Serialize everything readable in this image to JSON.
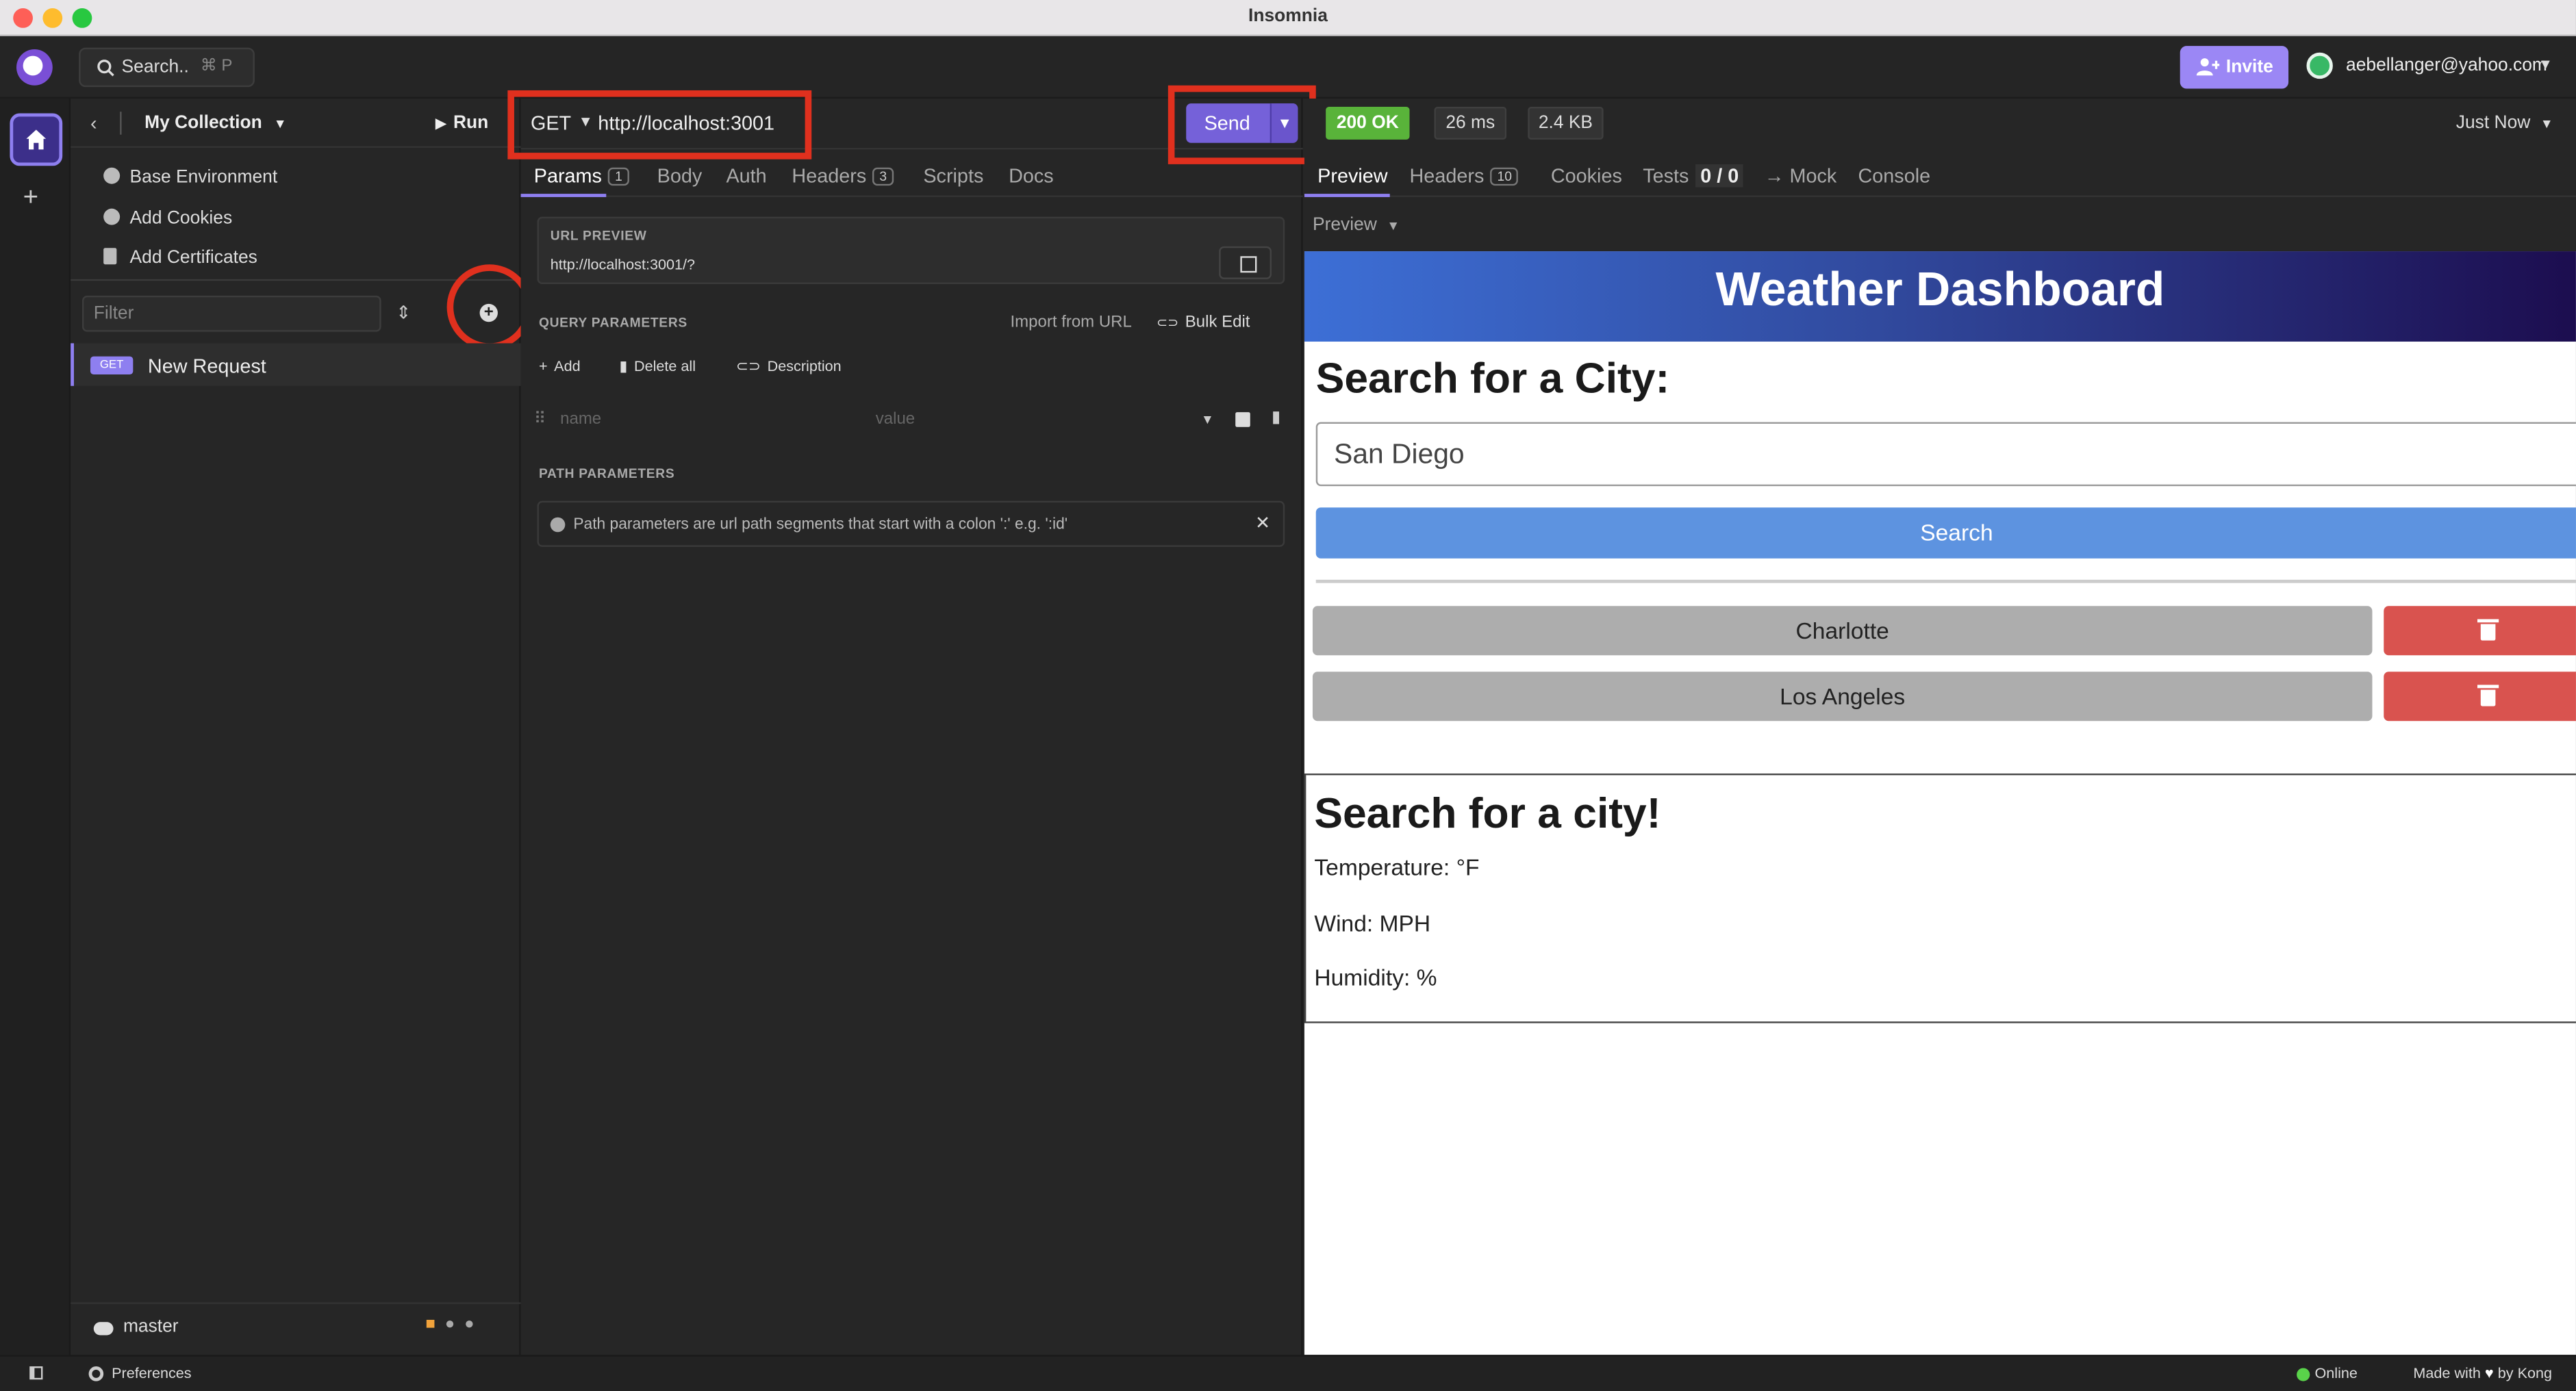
{
  "window": {
    "title": "Insomnia"
  },
  "topbar": {
    "search_label": "Search..",
    "search_shortcut": "⌘ P",
    "invite_label": "Invite",
    "user_email": "aebellanger@yahoo.com"
  },
  "sidebar": {
    "collection_name": "My Collection",
    "run_label": "Run",
    "items": [
      {
        "label": "Base Environment",
        "icon": "globe-icon"
      },
      {
        "label": "Add Cookies",
        "icon": "cookie-icon"
      },
      {
        "label": "Add Certificates",
        "icon": "certificate-icon"
      }
    ],
    "filter_placeholder": "Filter",
    "requests": [
      {
        "method": "GET",
        "name": "New Request"
      }
    ],
    "branch": "master"
  },
  "request": {
    "method": "GET",
    "url": "http://localhost:3001",
    "send_label": "Send",
    "tabs": [
      {
        "label": "Params",
        "count": "1"
      },
      {
        "label": "Body"
      },
      {
        "label": "Auth"
      },
      {
        "label": "Headers",
        "count": "3"
      },
      {
        "label": "Scripts"
      },
      {
        "label": "Docs"
      }
    ],
    "url_preview_label": "URL PREVIEW",
    "url_preview_value": "http://localhost:3001/?",
    "query_params_label": "QUERY PARAMETERS",
    "import_from_url": "Import from URL",
    "bulk_edit": "Bulk Edit",
    "add_label": "Add",
    "delete_all_label": "Delete all",
    "description_label": "Description",
    "name_placeholder": "name",
    "value_placeholder": "value",
    "path_params_label": "PATH PARAMETERS",
    "path_params_info": "Path parameters are url path segments that start with a colon ':' e.g. ':id'"
  },
  "response": {
    "status": "200 OK",
    "time": "26 ms",
    "size": "2.4 KB",
    "timestamp": "Just Now",
    "tabs": [
      {
        "label": "Preview"
      },
      {
        "label": "Headers",
        "count": "10"
      },
      {
        "label": "Cookies"
      },
      {
        "label": "Tests",
        "count": "0 / 0"
      },
      {
        "label": "→ Mock"
      },
      {
        "label": "Console"
      }
    ],
    "preview_mode": "Preview"
  },
  "webpage": {
    "title": "Weather Dashboard",
    "search_heading": "Search for a City:",
    "search_value": "San Diego",
    "search_button": "Search",
    "history": [
      "Charlotte",
      "Los Angeles"
    ],
    "weather_heading": "Search for a city!",
    "temperature": "Temperature: °F",
    "wind": "Wind: MPH",
    "humidity": "Humidity: %"
  },
  "statusbar": {
    "preferences": "Preferences",
    "online": "Online",
    "made_with_prefix": "Made with",
    "made_with_suffix": "by Kong"
  },
  "colors": {
    "accent": "#8e7ff0",
    "send": "#7561d9",
    "status_ok": "#59b33a",
    "annotation": "#e0301e",
    "delete": "#d9534f"
  }
}
